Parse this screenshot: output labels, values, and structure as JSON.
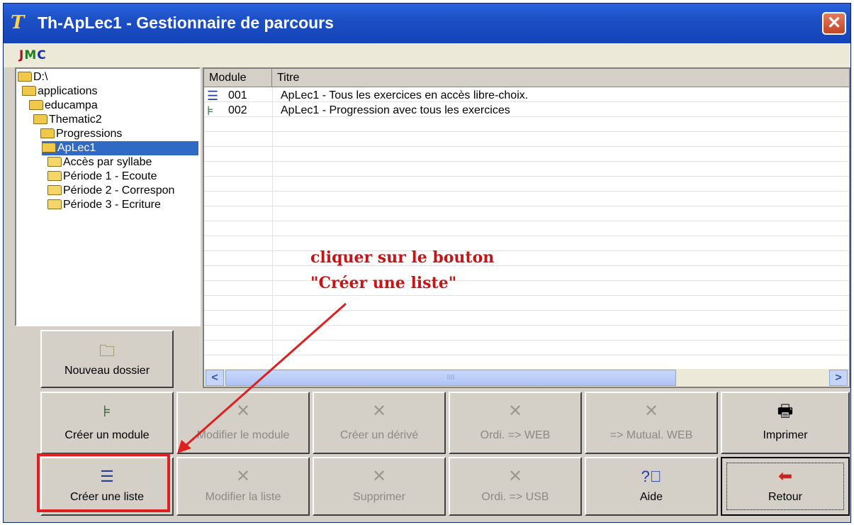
{
  "window": {
    "app_icon": "T",
    "title": "Th-ApLec1 - Gestionnaire de parcours",
    "close_glyph": "✕"
  },
  "logo": {
    "part_a": "J",
    "part_b": "M",
    "part_c": "C"
  },
  "tree": {
    "items": [
      {
        "label": "D:\\",
        "icon": "open-folder-icon"
      },
      {
        "label": "applications",
        "icon": "open-folder-icon"
      },
      {
        "label": "educampa",
        "icon": "open-folder-icon"
      },
      {
        "label": "Thematic2",
        "icon": "open-folder-icon"
      },
      {
        "label": "Progressions",
        "icon": "open-folder-icon"
      },
      {
        "label": "ApLec1",
        "icon": "open-folder-icon",
        "selected": true
      },
      {
        "label": "Accès par syllabe",
        "icon": "folder-icon"
      },
      {
        "label": "Période 1 - Ecoute",
        "icon": "folder-icon"
      },
      {
        "label": "Période 2 - Correspon",
        "icon": "folder-icon"
      },
      {
        "label": "Période 3 - Ecriture",
        "icon": "folder-icon"
      }
    ]
  },
  "list": {
    "columns": [
      "Module",
      "Titre"
    ],
    "rows": [
      {
        "icon": "list-icon",
        "module": "001",
        "title": "ApLec1 - Tous les exercices en accès libre-choix."
      },
      {
        "icon": "module-tree-icon",
        "module": "002",
        "title": "ApLec1 - Progression avec tous les exercices"
      }
    ],
    "scroll_left": "<",
    "scroll_right": ">",
    "scroll_grip": "IIII"
  },
  "buttons": {
    "nouveau_dossier": "Nouveau dossier",
    "creer_module": "Créer un module",
    "modifier_module": "Modifier le module",
    "creer_derive": "Créer un dérivé",
    "ordi_web": "Ordi. => WEB",
    "mutual_web": "=> Mutual. WEB",
    "imprimer": "Imprimer",
    "creer_liste": "Créer une liste",
    "modifier_liste": "Modifier la liste",
    "supprimer": "Supprimer",
    "ordi_usb": "Ordi. => USB",
    "aide": "Aide",
    "retour": "Retour"
  },
  "annotation": {
    "line1": "cliquer sur le bouton",
    "line2": "\"Créer une liste\"",
    "color": "#c81414"
  },
  "colors": {
    "titlebar": "#1c4fc4",
    "selection": "#316ac5",
    "face": "#d4d0c8",
    "highlight_box": "#e02020"
  }
}
